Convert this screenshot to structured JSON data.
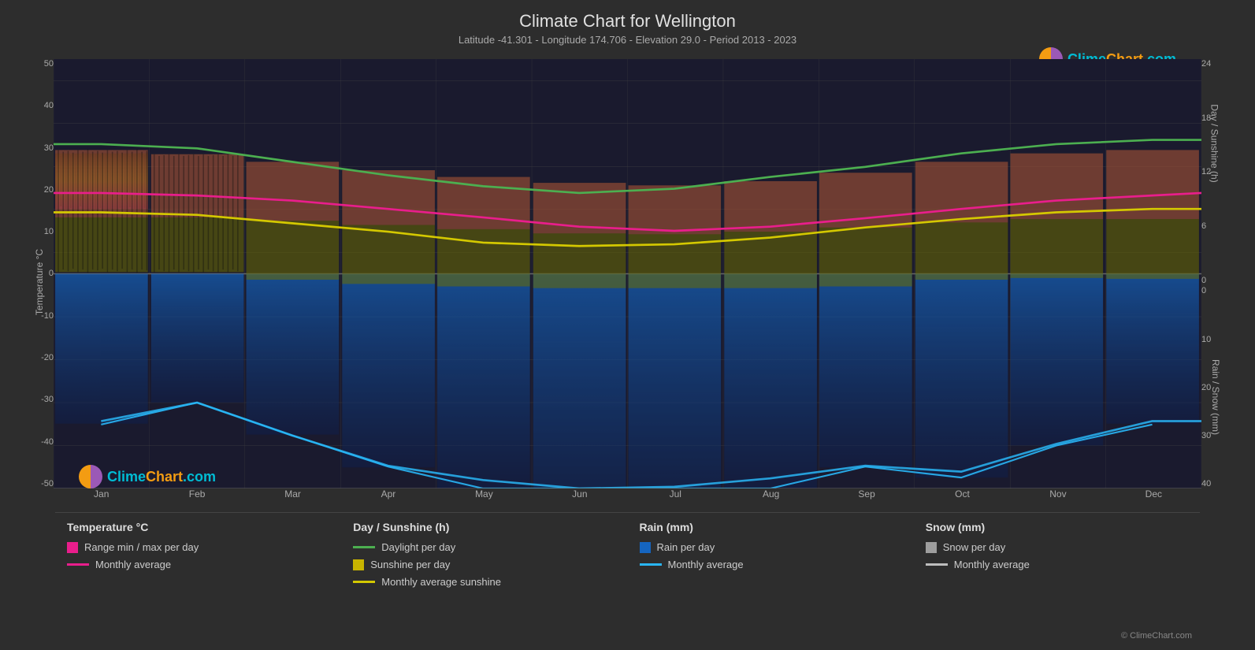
{
  "page": {
    "title": "Climate Chart for Wellington",
    "subtitle": "Latitude -41.301 - Longitude 174.706 - Elevation 29.0 - Period 2013 - 2023",
    "logo_text": "ClimeChart.com",
    "copyright": "© ClimeChart.com"
  },
  "axes": {
    "left_title": "Temperature °C",
    "right_title_1": "Day / Sunshine (h)",
    "right_title_2": "Rain / Snow (mm)",
    "left_labels": [
      "50",
      "40",
      "30",
      "20",
      "10",
      "0",
      "-10",
      "-20",
      "-30",
      "-40",
      "-50"
    ],
    "right_labels_1": [
      "24",
      "18",
      "12",
      "6",
      "0"
    ],
    "right_labels_2": [
      "0",
      "10",
      "20",
      "30",
      "40"
    ],
    "x_labels": [
      "Jan",
      "Feb",
      "Mar",
      "Apr",
      "May",
      "Jun",
      "Jul",
      "Aug",
      "Sep",
      "Oct",
      "Nov",
      "Dec"
    ]
  },
  "legend": {
    "col1": {
      "title": "Temperature °C",
      "items": [
        {
          "type": "swatch",
          "color": "#e91e8c",
          "label": "Range min / max per day"
        },
        {
          "type": "line",
          "color": "#e91e8c",
          "label": "Monthly average"
        }
      ]
    },
    "col2": {
      "title": "Day / Sunshine (h)",
      "items": [
        {
          "type": "line",
          "color": "#4caf50",
          "label": "Daylight per day"
        },
        {
          "type": "swatch",
          "color": "#c8b400",
          "label": "Sunshine per day"
        },
        {
          "type": "line",
          "color": "#d4c800",
          "label": "Monthly average sunshine"
        }
      ]
    },
    "col3": {
      "title": "Rain (mm)",
      "items": [
        {
          "type": "swatch",
          "color": "#1565c0",
          "label": "Rain per day"
        },
        {
          "type": "line",
          "color": "#29b6f6",
          "label": "Monthly average"
        }
      ]
    },
    "col4": {
      "title": "Snow (mm)",
      "items": [
        {
          "type": "swatch",
          "color": "#9e9e9e",
          "label": "Snow per day"
        },
        {
          "type": "line",
          "color": "#bdbdbd",
          "label": "Monthly average"
        }
      ]
    }
  }
}
